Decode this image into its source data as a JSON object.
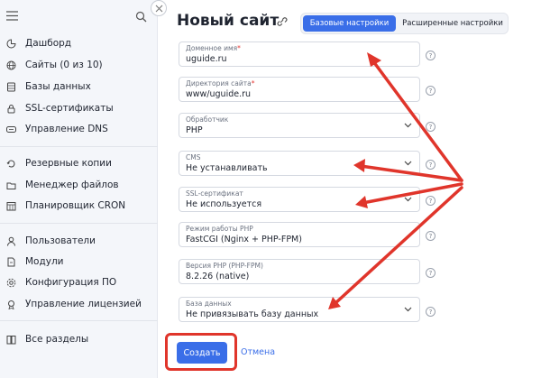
{
  "sidebar": {
    "items": [
      {
        "icon": "dashboard-icon",
        "label": "Дашборд"
      },
      {
        "icon": "globe-icon",
        "label": "Сайты (0 из 10)"
      },
      {
        "icon": "database-icon",
        "label": "Базы данных"
      },
      {
        "icon": "lock-icon",
        "label": "SSL-сертификаты"
      },
      {
        "icon": "dns-icon",
        "label": "Управление DNS"
      },
      {
        "icon": "backup-icon",
        "label": "Резервные копии"
      },
      {
        "icon": "folder-icon",
        "label": "Менеджер файлов"
      },
      {
        "icon": "calendar-icon",
        "label": "Планировщик CRON"
      },
      {
        "icon": "user-icon",
        "label": "Пользователи"
      },
      {
        "icon": "modules-icon",
        "label": "Модули"
      },
      {
        "icon": "settings-icon",
        "label": "Конфигурация ПО"
      },
      {
        "icon": "license-icon",
        "label": "Управление лицензией"
      },
      {
        "icon": "book-icon",
        "label": "Все разделы"
      }
    ]
  },
  "header": {
    "title": "Новый сайт",
    "tabs": [
      "Базовые настройки",
      "Расширенные настройки"
    ]
  },
  "form": {
    "fields": [
      {
        "label": "Доменное имя",
        "required": "*",
        "value": "uguide.ru"
      },
      {
        "label": "Директория сайта",
        "required": "*",
        "value": "www/uguide.ru"
      },
      {
        "label": "Обработчик",
        "required": "",
        "value": "PHP"
      },
      {
        "label": "CMS",
        "required": "",
        "value": "Не устанавливать"
      },
      {
        "label": "SSL-сертификат",
        "required": "",
        "value": "Не используется"
      },
      {
        "label": "Режим работы PHP",
        "required": "",
        "value": "FastCGI (Nginx + PHP-FPM)"
      },
      {
        "label": "Версия PHP (PHP-FPM)",
        "required": "",
        "value": "8.2.26 (native)"
      },
      {
        "label": "База данных",
        "required": "",
        "value": "Не привязывать базу данных"
      }
    ],
    "help_symbol": "?"
  },
  "actions": {
    "create_label": "Создать",
    "cancel_label": "Отмена"
  },
  "colors": {
    "accent": "#3a6ee8",
    "annotation": "#e0352b",
    "sidebar_bg": "#f4f6fa"
  }
}
